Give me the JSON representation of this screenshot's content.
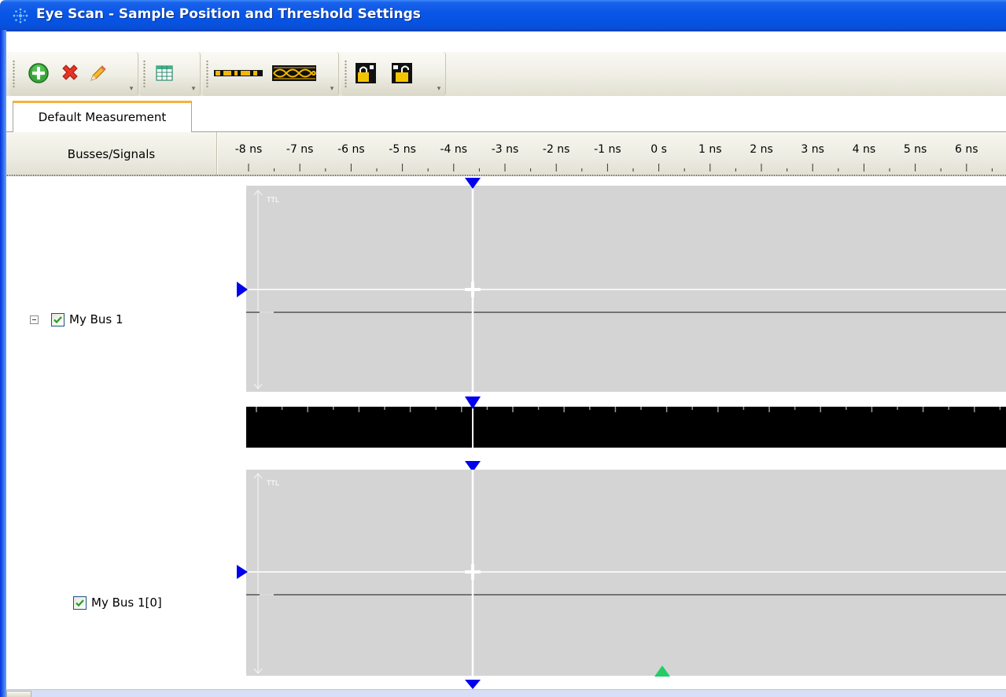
{
  "window": {
    "title": "Eye Scan - Sample Position and Threshold Settings"
  },
  "toolbar": {
    "groups": [
      {
        "name": "edit",
        "buttons": [
          "add-icon",
          "delete-icon",
          "edit-pencil-icon"
        ]
      },
      {
        "name": "view",
        "buttons": [
          "table-icon"
        ]
      },
      {
        "name": "display",
        "buttons": [
          "bus-waveform-icon",
          "eye-diagram-icon"
        ]
      },
      {
        "name": "lock",
        "buttons": [
          "lock-closed-icon",
          "lock-open-icon"
        ]
      }
    ]
  },
  "tabs": [
    {
      "label": "Default Measurement",
      "active": true
    }
  ],
  "header": {
    "signals_label": "Busses/Signals"
  },
  "ruler": {
    "ticks": [
      "-8 ns",
      "-7 ns",
      "-6 ns",
      "-5 ns",
      "-4 ns",
      "-3 ns",
      "-2 ns",
      "-1 ns",
      "0 s",
      "1 ns",
      "2 ns",
      "3 ns",
      "4 ns",
      "5 ns",
      "6 ns"
    ]
  },
  "signals": [
    {
      "label": "My Bus 1",
      "checked": true,
      "expanded": true,
      "level": 0,
      "threshold_label": "TTL"
    },
    {
      "label": "My Bus 1[0]",
      "checked": true,
      "level": 1,
      "threshold_label": "TTL"
    }
  ],
  "colors": {
    "marker_blue": "#0000ee",
    "marker_green": "#22cc66",
    "plot_bg": "#d4d4d4",
    "titlebar": "#0a56e6",
    "tab_accent": "#f4b43a"
  }
}
